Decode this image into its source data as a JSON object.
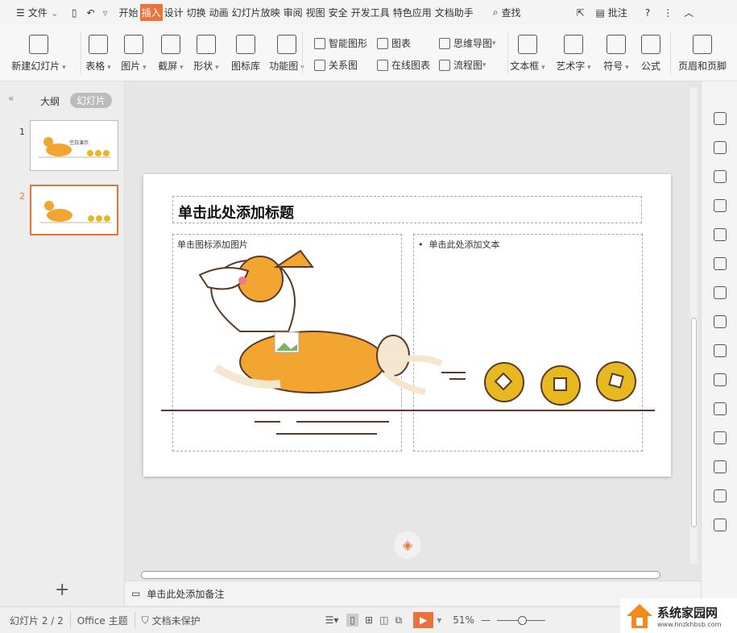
{
  "menubar": {
    "file": "文件",
    "tabs": [
      "开始",
      "插入",
      "设计",
      "切换",
      "动画",
      "幻灯片放映",
      "审阅",
      "视图",
      "安全",
      "开发工具",
      "特色应用",
      "文档助手"
    ],
    "active_tab": "插入",
    "search": "查找",
    "comment": "批注"
  },
  "ribbon": {
    "large": [
      "新建幻灯片",
      "表格",
      "图片",
      "截屏",
      "形状",
      "图标库",
      "功能图",
      "文本框",
      "艺术字",
      "符号",
      "公式",
      "页眉和页脚"
    ],
    "small": [
      "智能图形",
      "关系图",
      "图表",
      "在线图表",
      "思维导图",
      "流程图"
    ]
  },
  "left_panel": {
    "tab_outline": "大纲",
    "tab_slides": "幻灯片",
    "slides": [
      "1",
      "2"
    ],
    "thumb1_title": "空白演示",
    "add": "+"
  },
  "slide": {
    "title_placeholder": "单击此处添加标题",
    "image_placeholder": "单击图标添加图片",
    "text_placeholder": "单击此处添加文本"
  },
  "notes": {
    "placeholder": "单击此处添加备注"
  },
  "status": {
    "slide_count": "幻灯片 2 / 2",
    "theme": "Office 主题",
    "protection": "文档未保护",
    "zoom": "51%"
  },
  "watermark": {
    "name": "系统家园网",
    "url": "www.hnzkhbsb.com"
  },
  "colors": {
    "accent": "#e9733a",
    "corgi_orange": "#f2a531",
    "coin": "#e8b820"
  }
}
